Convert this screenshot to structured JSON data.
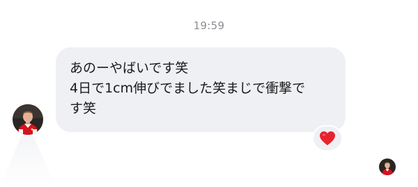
{
  "conversation": {
    "timestamp": "19:59",
    "message": {
      "text": "あのーやばいです笑\n4日で1cm伸びでました笑まじで衝撃で\nす笑",
      "reaction": {
        "emoji_name": "red-heart",
        "color": "#e8232d"
      }
    },
    "colors": {
      "bubble": "#eff0f4",
      "timestamp": "#8a8d91",
      "jersey": "#d6121f"
    }
  }
}
